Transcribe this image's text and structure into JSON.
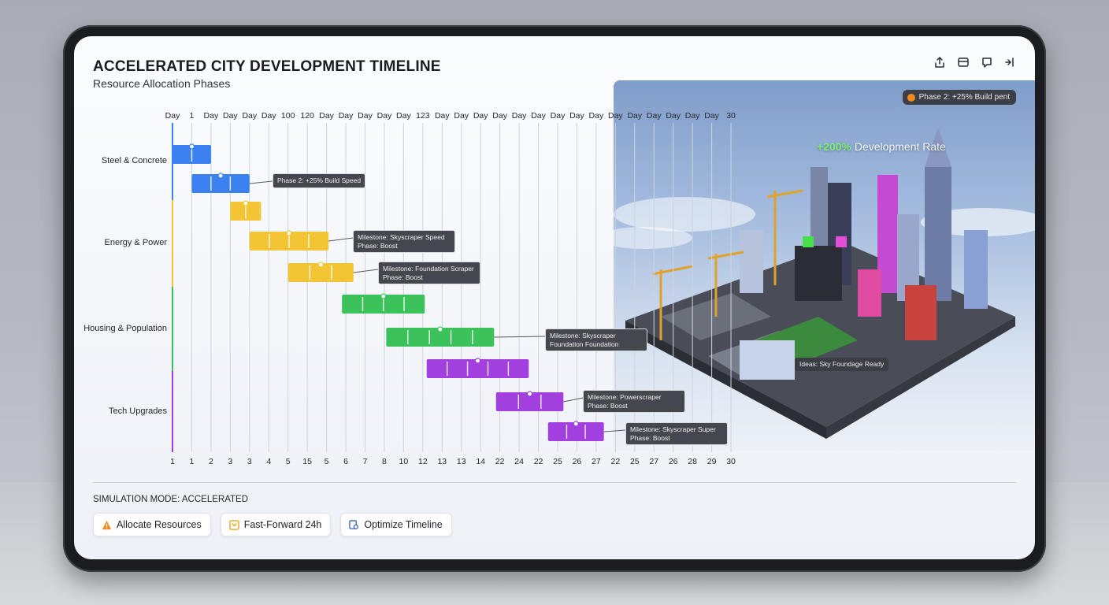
{
  "app": {
    "title": "ACCELERATED CITY DEVELOPMENT TIMELINE",
    "subtitle": "Resource Allocation Phases"
  },
  "toolbar": [
    {
      "name": "share-icon"
    },
    {
      "name": "layout-icon"
    },
    {
      "name": "comment-icon"
    },
    {
      "name": "collapse-icon"
    }
  ],
  "chart_data": {
    "type": "gantt",
    "top_axis": [
      "Day",
      "1",
      "Day",
      "Day",
      "Day",
      "Day",
      "100",
      "120",
      "Day",
      "Day",
      "Day",
      "Day",
      "Day",
      "123",
      "Day",
      "Day",
      "Day",
      "Day",
      "Day",
      "Day",
      "Day",
      "Day",
      "Day",
      "Day",
      "Day",
      "Day",
      "Day",
      "Day",
      "Day",
      "30"
    ],
    "bottom_axis": [
      "1",
      "1",
      "2",
      "3",
      "3",
      "4",
      "5",
      "15",
      "5",
      "6",
      "7",
      "8",
      "10",
      "12",
      "13",
      "13",
      "14",
      "22",
      "24",
      "22",
      "25",
      "26",
      "27",
      "22",
      "25",
      "27",
      "26",
      "28",
      "29",
      "30"
    ],
    "groups": [
      {
        "label": "Steel & Concrete",
        "color": "#3b82f0"
      },
      {
        "label": "Energy & Power",
        "color": "#f3c534"
      },
      {
        "label": "Housing & Population",
        "color": "#3cc25a"
      },
      {
        "label": "Tech Upgrades",
        "color": "#a23fdf"
      }
    ],
    "tasks": [
      {
        "group": 0,
        "start": 1,
        "end": 3
      },
      {
        "group": 0,
        "start": 2,
        "end": 5
      },
      {
        "group": 1,
        "start": 4,
        "end": 5.6
      },
      {
        "group": 1,
        "start": 5,
        "end": 9.1
      },
      {
        "group": 1,
        "start": 7,
        "end": 10.4
      },
      {
        "group": 2,
        "start": 9.8,
        "end": 14.1
      },
      {
        "group": 2,
        "start": 12.1,
        "end": 17.7
      },
      {
        "group": 3,
        "start": 14.2,
        "end": 19.5
      },
      {
        "group": 3,
        "start": 17.8,
        "end": 21.3
      },
      {
        "group": 3,
        "start": 20.5,
        "end": 23.4
      }
    ],
    "annotations": [
      "Phase 2: +25% Build Speed",
      "Milestone: Skyscraper Speed Phase: Boost",
      "Milestone: Foundation Scraper Phase: Boost",
      "Milestone: Skyscraper Foundation Foundation",
      "Milestone: Powerscraper Phase: Boost",
      "Milestone: Skyscraper Super Phase: Boost"
    ]
  },
  "photo": {
    "badge": "Phase 2: +25% Build pent",
    "rate_pct": "+200%",
    "rate_label": " Development Rate",
    "note": "Ideas: Sky Foundage Ready"
  },
  "footer": {
    "mode": "SIMULATION MODE: ACCELERATED",
    "buttons": [
      {
        "label": "Allocate Resources",
        "icon": "warning-icon",
        "color": "#f08a1c"
      },
      {
        "label": "Fast-Forward 24h",
        "icon": "fast-forward-icon",
        "color": "#f0a21c"
      },
      {
        "label": "Optimize Timeline",
        "icon": "optimize-icon",
        "color": "#3a5fb8"
      }
    ]
  }
}
